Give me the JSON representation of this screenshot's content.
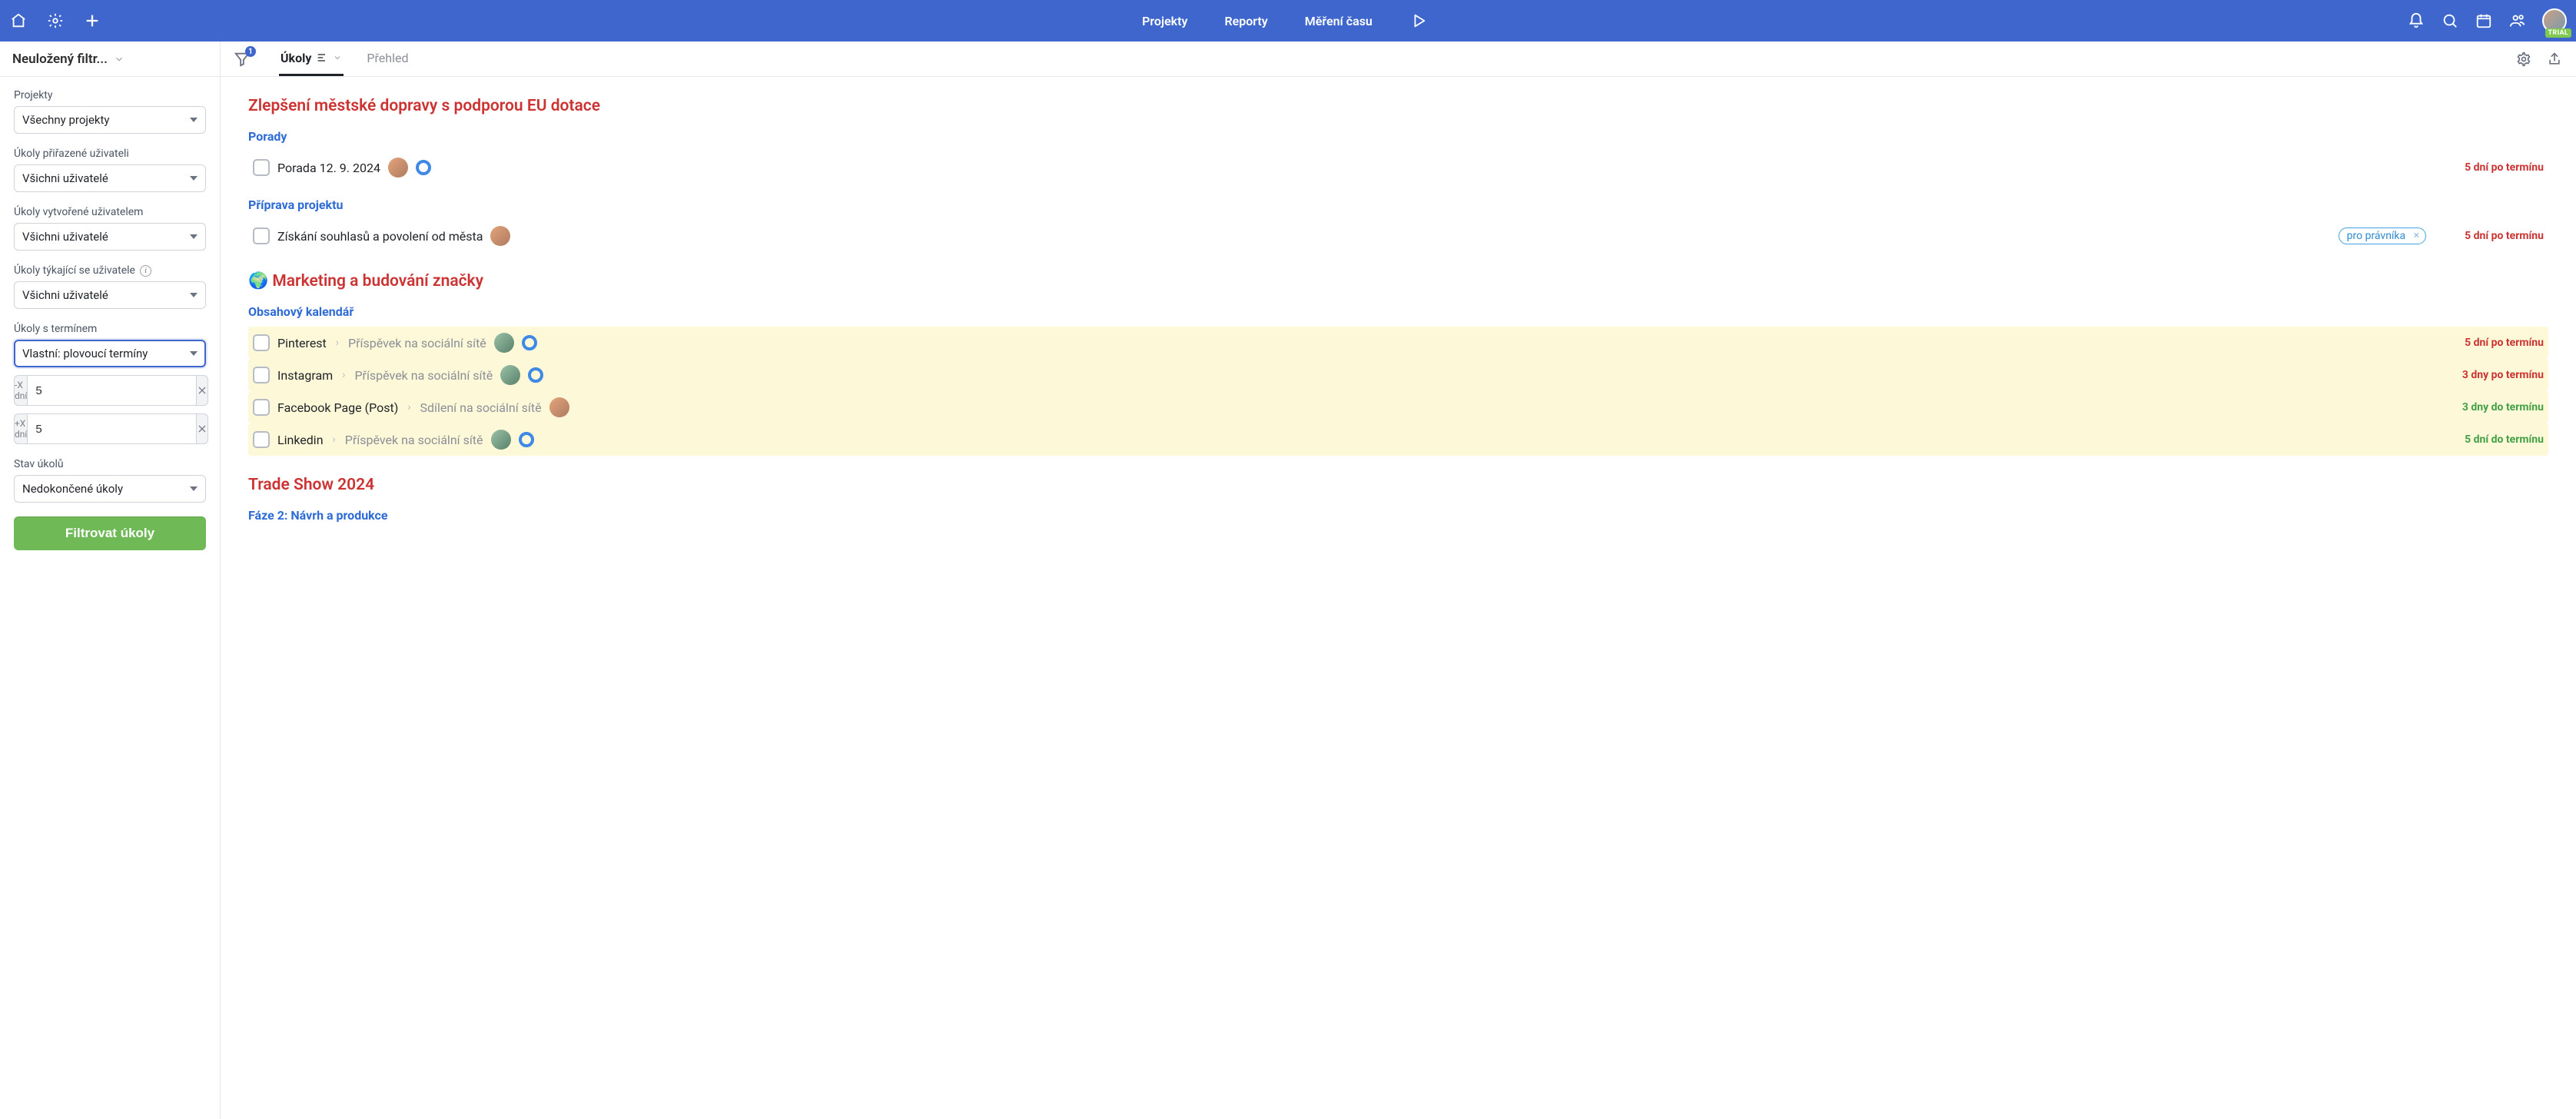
{
  "topbar": {
    "nav": {
      "projects": "Projekty",
      "reports": "Reporty",
      "time": "Měření času"
    },
    "trial_badge": "TRIAL"
  },
  "secbar": {
    "filterset_name": "Neuložený filtr...",
    "presets_badge": "1",
    "tabs": {
      "tasks": "Úkoly",
      "overview": "Přehled"
    }
  },
  "sidebar": {
    "projects_label": "Projekty",
    "projects_value": "Všechny projekty",
    "assigned_label": "Úkoly přiřazené uživateli",
    "assigned_value": "Všichni uživatelé",
    "created_label": "Úkoly vytvořené uživatelem",
    "created_value": "Všichni uživatelé",
    "related_label": "Úkoly týkající se uživatele",
    "related_value": "Všichni uživatelé",
    "deadline_label": "Úkoly s termínem",
    "deadline_value": "Vlastní: plovoucí termíny",
    "minus_prefix": "-X dní",
    "minus_value": "5",
    "plus_prefix": "+X dní",
    "plus_value": "5",
    "status_label": "Stav úkolů",
    "status_value": "Nedokončené úkoly",
    "submit": "Filtrovat úkoly"
  },
  "content": {
    "p1": {
      "title": "Zlepšení městské dopravy s podporou EU dotace",
      "s1": {
        "title": "Porady",
        "tasks": [
          {
            "name": "Porada 12. 9. 2024",
            "due": "5 dní po termínu",
            "due_kind": "over",
            "prio": true
          }
        ]
      },
      "s2": {
        "title": "Příprava projektu",
        "tasks": [
          {
            "name": "Získání souhlasů a povolení od města",
            "due": "5 dní po termínu",
            "due_kind": "over",
            "tag": "pro právníka"
          }
        ]
      }
    },
    "p2": {
      "emoji": "🌍",
      "title": "Marketing a budování značky",
      "s1": {
        "title": "Obsahový kalendář",
        "tasks": [
          {
            "name": "Pinterest",
            "sub": "Příspěvek na sociální sítě",
            "due": "5 dní po termínu",
            "due_kind": "over",
            "prio": true
          },
          {
            "name": "Instagram",
            "sub": "Příspěvek na sociální sítě",
            "due": "3 dny po termínu",
            "due_kind": "over",
            "prio": true
          },
          {
            "name": "Facebook Page (Post)",
            "sub": "Sdílení na sociální sítě",
            "due": "3 dny do termínu",
            "due_kind": "near"
          },
          {
            "name": "Linkedin",
            "sub": "Příspěvek na sociální sítě",
            "due": "5 dní do termínu",
            "due_kind": "near",
            "prio": true
          }
        ]
      }
    },
    "p3": {
      "title": "Trade Show 2024",
      "s1": {
        "title": "Fáze 2: Návrh a produkce"
      }
    }
  }
}
